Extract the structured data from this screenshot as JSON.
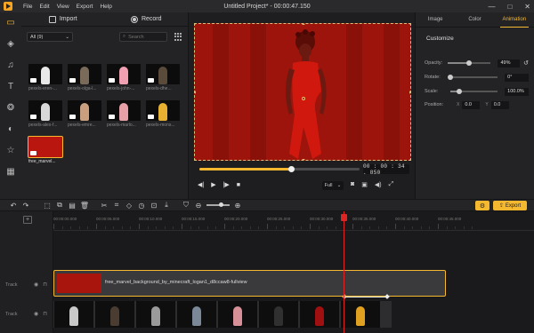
{
  "app": {
    "title": "Untitled Project* - 00:00:47.150",
    "menu": [
      "File",
      "Edit",
      "View",
      "Export",
      "Help"
    ],
    "window_controls": [
      "—",
      "□",
      "✕"
    ]
  },
  "rail": {
    "icons": [
      "folder-icon",
      "layers-icon",
      "music-icon",
      "text-icon",
      "effects-icon",
      "transition-icon",
      "sticker-icon",
      "template-icon"
    ]
  },
  "media": {
    "import_label": "Import",
    "record_label": "Record",
    "filter": "All (9)",
    "search_placeholder": "Search",
    "items": [
      {
        "name": "pexels-eren-...",
        "accent": "#e8e8e8"
      },
      {
        "name": "pexels-olga-l...",
        "accent": "#7a6a5a"
      },
      {
        "name": "pexels-john-...",
        "accent": "#f0a0b0"
      },
      {
        "name": "pexels-dhe...",
        "accent": "#5a4a3a"
      },
      {
        "name": "pexels-alex-f...",
        "accent": "#d8d8d8"
      },
      {
        "name": "pexels-emre...",
        "accent": "#c8a080"
      },
      {
        "name": "pexels-marlo...",
        "accent": "#e8a0a8"
      },
      {
        "name": "pexels-mons...",
        "accent": "#e8b030"
      },
      {
        "name": "free_marvel...",
        "accent": "#b8160f",
        "selected": true
      }
    ]
  },
  "preview": {
    "timecode": "00 : 00 : 34 . 850",
    "progress": 0.57,
    "quality": "Full",
    "controls": [
      "prev-frame",
      "play",
      "next-frame",
      "stop"
    ]
  },
  "properties": {
    "tabs": [
      "Image",
      "Color",
      "Animation"
    ],
    "active_tab": "Animation",
    "section": "Customize",
    "rows": {
      "opacity": {
        "label": "Opacity:",
        "value": "49%",
        "level": 0.49
      },
      "rotate": {
        "label": "Rotate:",
        "value": "0°",
        "level": 0.0
      },
      "scale": {
        "label": "Scale:",
        "value": "100.0%",
        "level": 0.2
      },
      "position": {
        "label": "Position:",
        "x_label": "X",
        "x": "0.0",
        "y_label": "Y",
        "y": "0.0"
      }
    }
  },
  "toolbar": {
    "export_label": "Export"
  },
  "timeline": {
    "ruler": [
      "00:00:00.000",
      "00:00:05.000",
      "00:00:10.000",
      "00:00:15.000",
      "00:00:20.000",
      "00:00:25.000",
      "00:00:30.000",
      "00:00:35.000",
      "00:00:40.000",
      "00:00:45.000"
    ],
    "track1_label": "Track",
    "track2_label": "Track",
    "clip_title": "free_marvel_background_by_minecraft_logan1_d8ccaw8-fullview",
    "frames": [
      "#c8c8c8",
      "#4a3c30",
      "#9a9a9a",
      "#7a8898",
      "#d89098",
      "#303030",
      "#a01010",
      "#e0a020"
    ]
  }
}
